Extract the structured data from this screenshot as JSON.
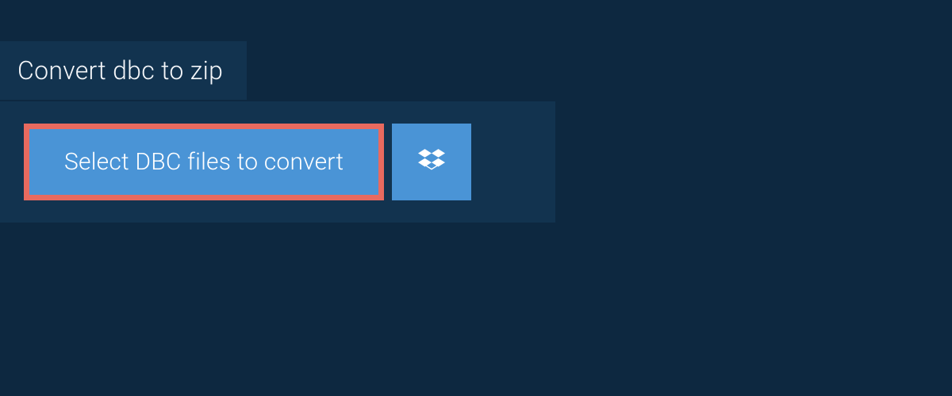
{
  "tab": {
    "label": "Convert dbc to zip"
  },
  "actions": {
    "select_label": "Select DBC files to convert"
  },
  "colors": {
    "page_bg": "#0d2840",
    "panel_bg": "#12334f",
    "button_bg": "#4a94d6",
    "highlight_border": "#e86a5f"
  }
}
